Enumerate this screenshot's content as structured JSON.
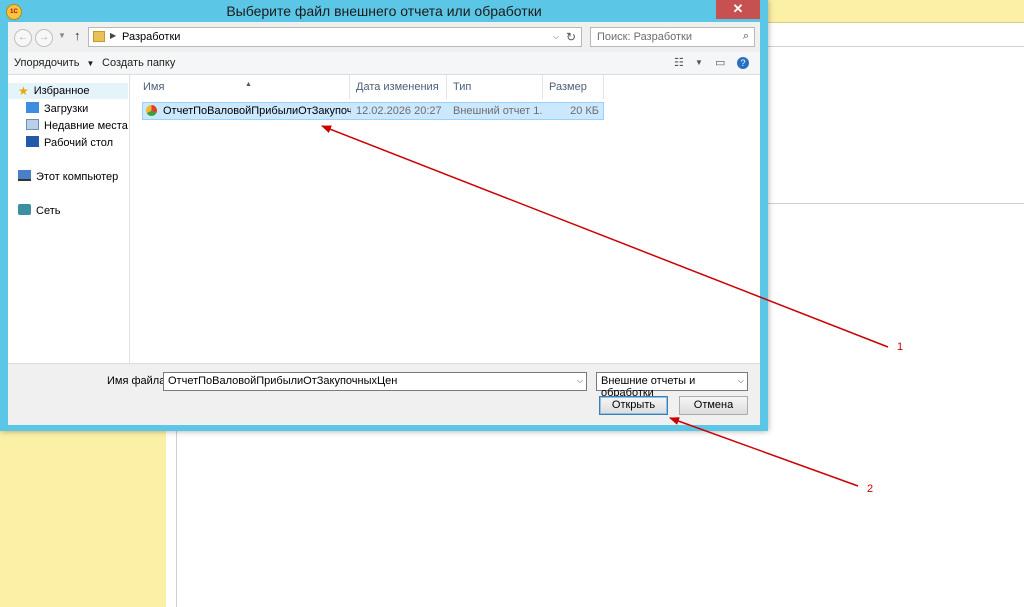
{
  "dialog": {
    "title": "Выберите файл внешнего отчета или обработки",
    "close_label": "✕",
    "app_icon_label": "1С"
  },
  "address": {
    "path": "Разработки",
    "search_placeholder": "Поиск: Разработки"
  },
  "toolbar": {
    "organize_label": "Упорядочить",
    "new_folder_label": "Создать папку"
  },
  "nav": {
    "favorites": "Избранное",
    "downloads": "Загрузки",
    "recent": "Недавние места",
    "desktop": "Рабочий стол",
    "computer": "Этот компьютер",
    "network": "Сеть"
  },
  "files": {
    "columns": [
      "Имя",
      "Дата изменения",
      "Тип",
      "Размер"
    ],
    "rows": [
      {
        "name": "ОтчетПоВаловойПрибылиОтЗакупочн...",
        "date": "12.02.2026 20:27",
        "type": "Внешний отчет 1...",
        "size": "20 КБ"
      }
    ]
  },
  "footer": {
    "filename_label": "Имя файла:",
    "filename_value": "ОтчетПоВаловойПрибылиОтЗакупочныхЦен",
    "filetype_value": "Внешние отчеты и обработки",
    "open_label": "Открыть",
    "cancel_label": "Отмена"
  },
  "annotations": {
    "arrow1_label": "1",
    "arrow2_label": "2",
    "color": "#cc0000"
  },
  "colors": {
    "window_frame": "#5cc6e7",
    "background_app": "#fbf0a6",
    "selection": "#cce8ff"
  }
}
